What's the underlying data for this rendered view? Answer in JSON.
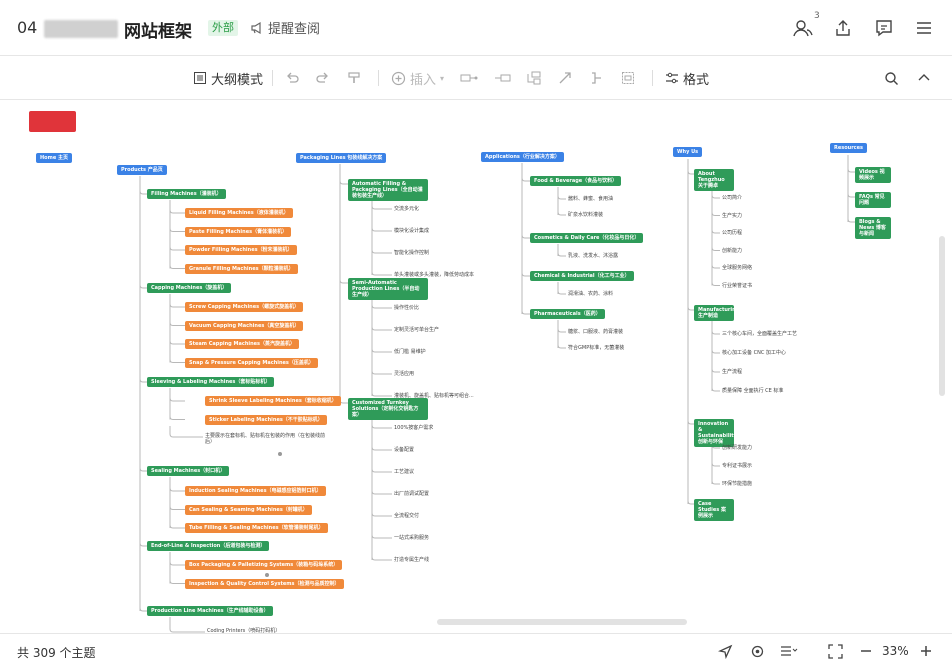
{
  "header": {
    "doc_number": "04",
    "doc_title": "网站框架",
    "badge": "外部",
    "remind_label": "提醒查阅",
    "collaborators_count": "3",
    "icons": [
      "collaborators-icon",
      "share-icon",
      "comment-icon",
      "menu-icon"
    ]
  },
  "toolbar": {
    "outline_mode": "大纲模式",
    "insert": "插入",
    "format": "格式"
  },
  "mindmap": {
    "roots": [
      {
        "id": "home",
        "label": "Home 主页"
      },
      {
        "id": "products",
        "label": "Products 产品页"
      },
      {
        "id": "packaging",
        "label": "Packaging Lines 包装线解决方案"
      },
      {
        "id": "applications",
        "label": "Applications（行业解决方案）"
      },
      {
        "id": "whyus",
        "label": "Why Us"
      },
      {
        "id": "resources",
        "label": "Resources"
      }
    ],
    "products": {
      "groups": [
        {
          "label": "Filling Machines（灌装机）",
          "items": [
            "Liquid Filling Machines（液体灌装机）",
            "Paste Filling Machines（膏体灌装机）",
            "Powder Filling Machines（粉末灌装机）",
            "Granule Filling Machines（颗粒灌装机）"
          ]
        },
        {
          "label": "Capping Machines（旋盖机）",
          "items": [
            "Screw Capping Machines（螺旋式旋盖机）",
            "Vacuum Capping Machines（真空旋盖机）",
            "Steam Capping Machines（蒸汽旋盖机）",
            "Snap & Pressure Capping Machines（压盖机）"
          ]
        },
        {
          "label": "Sleeving & Labeling Machines（套标贴标机）",
          "items": [
            "Shrink Sleeve Labeling Machines（套标收缩机）",
            "Sticker Labeling Machines（不干胶贴标机）"
          ],
          "note": "主要展示在套标机、贴标机在包装的作用（在包装线前后）"
        },
        {
          "label": "Sealing Machines（封口机）",
          "items": [
            "Induction Sealing Machines（电磁感应铝箔封口机）",
            "Can Sealing & Seaming Machines（封罐机）",
            "Tube Filling & Sealing Machines（软管灌装封尾机）"
          ]
        },
        {
          "label": "End-of-Line & Inspection（后道包装与检测）",
          "items": [
            "Box Packaging & Palletizing Systems（装箱与码垛系统）",
            "Inspection & Quality Control Systems（检测与品质控制）"
          ]
        },
        {
          "label": "Production Line Machines（生产线辅助设备）",
          "items": [
            "Coding Printers（喷码打码机）"
          ]
        }
      ]
    },
    "packaging": {
      "sections": [
        {
          "label": "Automatic Filling & Packaging Lines（全自动灌装包装生产线）",
          "items": [
            "交流多元化",
            "模块化设计集成",
            "智能化操作控制",
            "单头灌装或多头灌装，降低劳动成本"
          ]
        },
        {
          "label": "Semi-Automatic Production Lines（半自动生产线）",
          "items": [
            "操作性价比",
            "定制灵活可单台生产",
            "低门槛 易维护",
            "灵活应用",
            "灌装机、旋盖机、贴标机等可组合..."
          ]
        },
        {
          "label": "Customized Turnkey Solutions（定制化交钥匙方案）",
          "items": [
            "100%按客户需求",
            "设备配置",
            "工艺建议",
            "出厂前调试配置",
            "全流程交付",
            "一站式采购服务",
            "打造专属生产线"
          ]
        }
      ]
    },
    "applications": {
      "sections": [
        {
          "label": "Food & Beverage（食品与饮料）",
          "items": [
            "酱料、蜂蜜、食用油",
            "矿泉水饮料灌装"
          ]
        },
        {
          "label": "Cosmetics & Daily Care（化妆品与日化）",
          "items": [
            "乳液、洗发水、沐浴露"
          ]
        },
        {
          "label": "Chemical & Industrial（化工与工业）",
          "items": [
            "润滑油、农药、涂料"
          ]
        },
        {
          "label": "Pharmaceuticals（医药）",
          "items": [
            "糖浆、口服液、药膏灌装",
            "符合GMP标准，无菌灌装"
          ]
        }
      ]
    },
    "whyus": {
      "sections": [
        {
          "label": "About Tengzhuo 关于腾卓",
          "items": [
            "公司简介",
            "生产实力",
            "公司历程",
            "创新能力",
            "全球服务网络",
            "行业荣誉证书"
          ]
        },
        {
          "label": "Manufacturing 生产制造",
          "items": [
            "三个核心车间，全面覆盖生产工艺",
            "核心加工设备 CNC 加工中心",
            "生产流程",
            "质量保障 全面执行 CE 标准"
          ]
        },
        {
          "label": "Innovation & Sustainability 创新与环保",
          "items": [
            "创新研发能力",
            "专利证书展示",
            "环保节能措施"
          ]
        },
        {
          "label": "Case Studies 案例展示",
          "items": []
        }
      ]
    },
    "resources": {
      "items": [
        "Videos 视频展示",
        "FAQs 常见问题",
        "Blogs & News 博客与新闻"
      ]
    }
  },
  "statusbar": {
    "topic_count": "共 309 个主题",
    "zoom": "33%"
  }
}
